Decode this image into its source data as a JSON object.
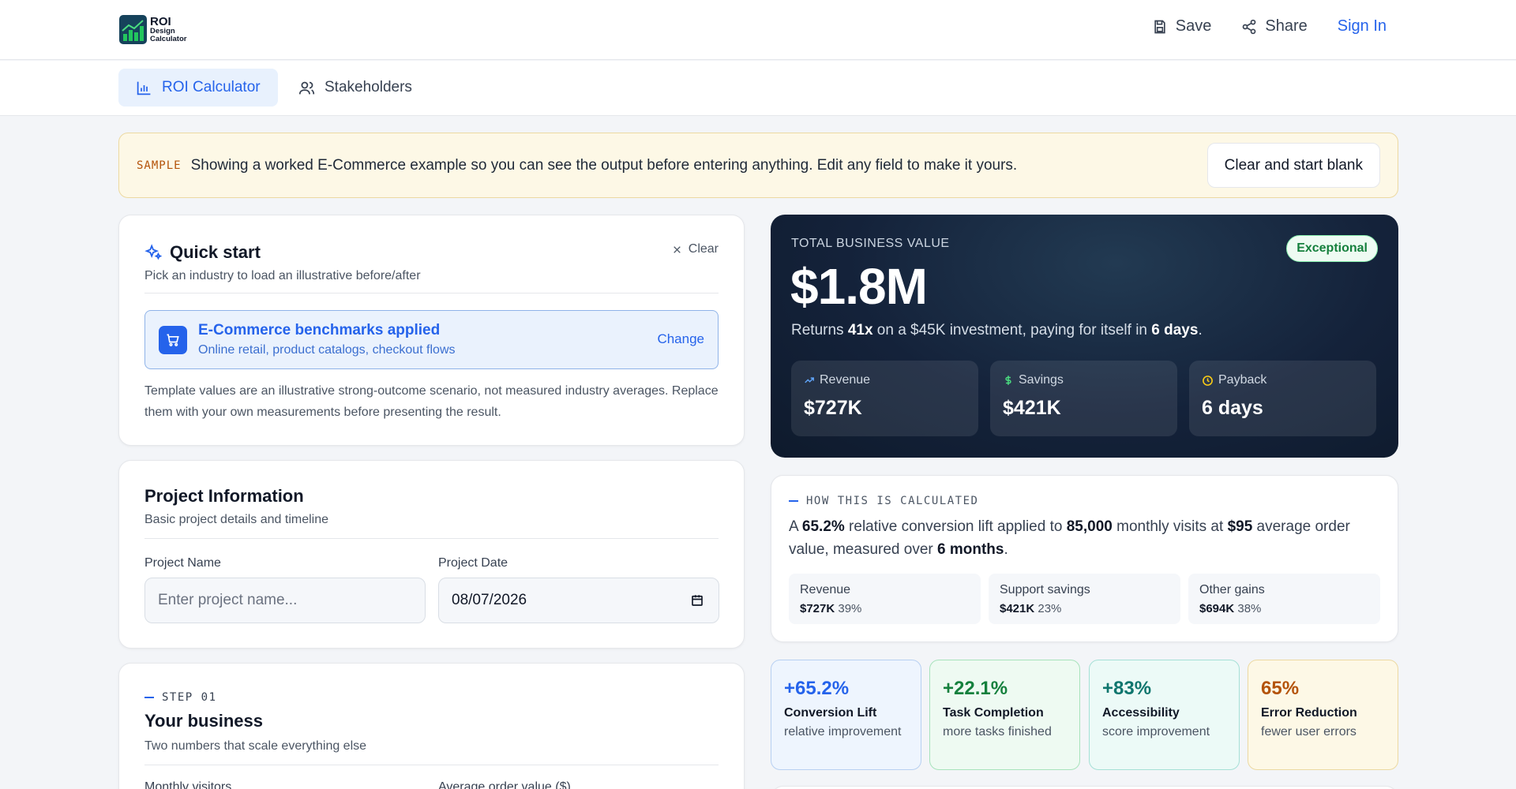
{
  "header": {
    "logo": {
      "line1": "ROI",
      "line2": "Design",
      "line3": "Calculator"
    },
    "save_label": "Save",
    "share_label": "Share",
    "signin_label": "Sign In"
  },
  "tabs": [
    {
      "label": "ROI Calculator",
      "icon": "bar-chart-icon",
      "active": true
    },
    {
      "label": "Stakeholders",
      "icon": "users-icon",
      "active": false
    }
  ],
  "banner": {
    "tag": "SAMPLE",
    "message": "Showing a worked E-Commerce example so you can see the output before entering anything. Edit any field to make it yours.",
    "button": "Clear and start blank"
  },
  "quick_start": {
    "title": "Quick start",
    "subtitle": "Pick an industry to load an illustrative before/after",
    "clear_label": "Clear",
    "applied_title": "E-Commerce benchmarks applied",
    "applied_sub": "Online retail, product catalogs, checkout flows",
    "change_label": "Change",
    "note": "Template values are an illustrative strong-outcome scenario, not measured industry averages. Replace them with your own measurements before presenting the result."
  },
  "project_info": {
    "title": "Project Information",
    "subtitle": "Basic project details and timeline",
    "name_label": "Project Name",
    "name_placeholder": "Enter project name...",
    "name_value": "",
    "date_label": "Project Date",
    "date_value": "08/07/2026"
  },
  "step1": {
    "tag": "STEP 01",
    "title": "Your business",
    "subtitle": "Two numbers that scale everything else",
    "field1_label": "Monthly visitors",
    "field2_label": "Average order value ($)"
  },
  "hero": {
    "label": "TOTAL BUSINESS VALUE",
    "value": "$1.8M",
    "badge": "Exceptional",
    "returns_pre": "Returns ",
    "returns_mult": "41x",
    "returns_mid": " on a $45K investment, paying for itself in ",
    "returns_days": "6 days",
    "returns_end": ".",
    "metrics": [
      {
        "label": "Revenue",
        "value": "$727K",
        "icon": "trending-up-icon",
        "color": "#60a5fa"
      },
      {
        "label": "Savings",
        "value": "$421K",
        "icon": "dollar-icon",
        "color": "#4ade80"
      },
      {
        "label": "Payback",
        "value": "6 days",
        "icon": "clock-icon",
        "color": "#facc15"
      }
    ]
  },
  "calc": {
    "tag": "HOW THIS IS CALCULATED",
    "p1": "A ",
    "lift": "65.2%",
    "p2": " relative conversion lift applied to ",
    "visits": "85,000",
    "p3": " monthly visits at ",
    "aov": "$95",
    "p4": " average order value, measured over ",
    "period": "6 months",
    "p5": ".",
    "breakdown": [
      {
        "label": "Revenue",
        "amount": "$727K",
        "pct": "39%"
      },
      {
        "label": "Support savings",
        "amount": "$421K",
        "pct": "23%"
      },
      {
        "label": "Other gains",
        "amount": "$694K",
        "pct": "38%"
      }
    ]
  },
  "tiles": [
    {
      "value": "+65.2%",
      "name": "Conversion Lift",
      "desc": "relative improvement",
      "color": "#2563eb",
      "bg": "#eef5fe",
      "border": "#b7d0f2"
    },
    {
      "value": "+22.1%",
      "name": "Task Completion",
      "desc": "more tasks finished",
      "color": "#15803d",
      "bg": "#eefaf2",
      "border": "#a7e3bb"
    },
    {
      "value": "+83%",
      "name": "Accessibility",
      "desc": "score improvement",
      "color": "#0f766e",
      "bg": "#ecfaf7",
      "border": "#a5e0d6"
    },
    {
      "value": "65%",
      "name": "Error Reduction",
      "desc": "fewer user errors",
      "color": "#b45309",
      "bg": "#fdf8e6",
      "border": "#ecd9a1"
    }
  ]
}
